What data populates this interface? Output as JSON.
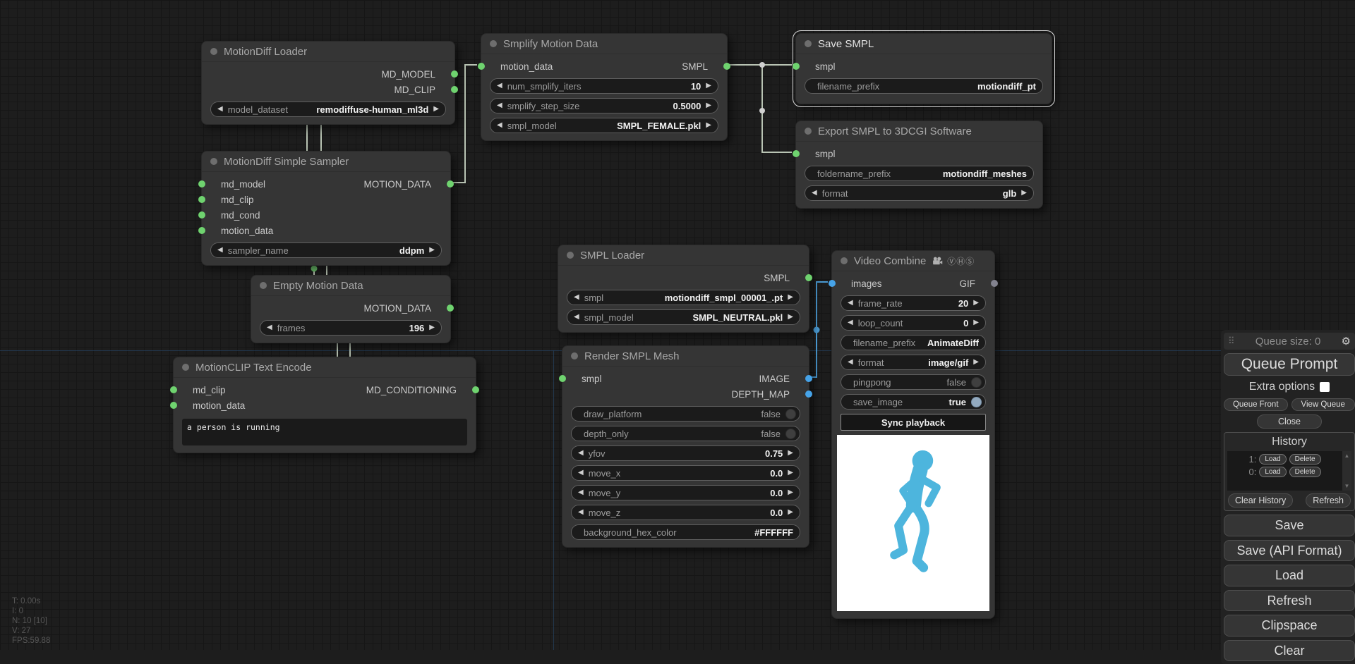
{
  "canvas": {
    "stats": [
      "T: 0.00s",
      "I: 0",
      "N: 10 [10]",
      "V: 27",
      "FPS:59.88"
    ]
  },
  "glyphs": {
    "arrow_left": "◀",
    "arrow_right": "▶",
    "gear": "⚙",
    "drag": "⠿",
    "scroll_up": "▲",
    "scroll_down": "▼",
    "vhs": "ⓋⒽⓈ"
  },
  "colors": {
    "slot_green": "#6fd36f",
    "slot_blue": "#46a3e8",
    "slot_gray": "#82828e",
    "wire_pale": "#b9c4b4",
    "wire_blue": "#4a9ad2",
    "selected_border": "#dcdcdc",
    "toggle_on": "#93aabf",
    "runner_blue": "#4db5dd",
    "preview_bg": "#ffffff"
  },
  "nodes": [
    {
      "id": "motiondiff_loader",
      "title": "MotionDiff Loader",
      "rows": [
        {
          "output": {
            "label": "MD_MODEL",
            "color": "green"
          }
        },
        {
          "output": {
            "label": "MD_CLIP",
            "color": "green"
          }
        }
      ],
      "widgets": [
        {
          "kind": "combo",
          "label": "model_dataset",
          "value": "remodiffuse-human_ml3d"
        }
      ]
    },
    {
      "id": "smplify_motion_data",
      "title": "Smplify Motion Data",
      "rows": [
        {
          "input": {
            "label": "motion_data",
            "color": "green"
          },
          "output": {
            "label": "SMPL",
            "color": "green"
          }
        }
      ],
      "widgets": [
        {
          "kind": "number",
          "label": "num_smplify_iters",
          "value": "10"
        },
        {
          "kind": "number",
          "label": "smplify_step_size",
          "value": "0.5000"
        },
        {
          "kind": "combo",
          "label": "smpl_model",
          "value": "SMPL_FEMALE.pkl"
        }
      ]
    },
    {
      "id": "save_smpl",
      "title": "Save SMPL",
      "selected": true,
      "rows": [
        {
          "input": {
            "label": "smpl",
            "color": "green"
          }
        }
      ],
      "widgets": [
        {
          "kind": "text",
          "label": "filename_prefix",
          "value": "motiondiff_pt"
        }
      ]
    },
    {
      "id": "export_smpl",
      "title": "Export SMPL to 3DCGI Software",
      "rows": [
        {
          "input": {
            "label": "smpl",
            "color": "green"
          }
        }
      ],
      "widgets": [
        {
          "kind": "text",
          "label": "foldername_prefix",
          "value": "motiondiff_meshes"
        },
        {
          "kind": "combo",
          "label": "format",
          "value": "glb"
        }
      ]
    },
    {
      "id": "motiondiff_simple_sampler",
      "title": "MotionDiff Simple Sampler",
      "rows": [
        {
          "input": {
            "label": "md_model",
            "color": "green"
          },
          "output": {
            "label": "MOTION_DATA",
            "color": "green"
          }
        },
        {
          "input": {
            "label": "md_clip",
            "color": "green"
          }
        },
        {
          "input": {
            "label": "md_cond",
            "color": "green"
          }
        },
        {
          "input": {
            "label": "motion_data",
            "color": "green"
          }
        }
      ],
      "widgets": [
        {
          "kind": "combo",
          "label": "sampler_name",
          "value": "ddpm"
        }
      ]
    },
    {
      "id": "empty_motion_data",
      "title": "Empty Motion Data",
      "rows": [
        {
          "output": {
            "label": "MOTION_DATA",
            "color": "green"
          }
        }
      ],
      "widgets": [
        {
          "kind": "number",
          "label": "frames",
          "value": "196"
        }
      ]
    },
    {
      "id": "smpl_loader",
      "title": "SMPL Loader",
      "rows": [
        {
          "output": {
            "label": "SMPL",
            "color": "green"
          }
        }
      ],
      "widgets": [
        {
          "kind": "combo",
          "label": "smpl",
          "value": "motiondiff_smpl_00001_.pt"
        },
        {
          "kind": "combo",
          "label": "smpl_model",
          "value": "SMPL_NEUTRAL.pkl"
        }
      ]
    },
    {
      "id": "motionclip_text_encode",
      "title": "MotionCLIP Text Encode",
      "rows": [
        {
          "input": {
            "label": "md_clip",
            "color": "green"
          },
          "output": {
            "label": "MD_CONDITIONING",
            "color": "green"
          }
        },
        {
          "input": {
            "label": "motion_data",
            "color": "green"
          }
        }
      ],
      "text": "a person is running"
    },
    {
      "id": "render_smpl_mesh",
      "title": "Render SMPL Mesh",
      "rows": [
        {
          "input": {
            "label": "smpl",
            "color": "green"
          },
          "output": {
            "label": "IMAGE",
            "color": "blue"
          }
        },
        {
          "output": {
            "label": "DEPTH_MAP",
            "color": "blue"
          }
        }
      ],
      "widgets": [
        {
          "kind": "toggle",
          "label": "draw_platform",
          "value": "false",
          "on": false
        },
        {
          "kind": "toggle",
          "label": "depth_only",
          "value": "false",
          "on": false
        },
        {
          "kind": "number",
          "label": "yfov",
          "value": "0.75"
        },
        {
          "kind": "number",
          "label": "move_x",
          "value": "0.0"
        },
        {
          "kind": "number",
          "label": "move_y",
          "value": "0.0"
        },
        {
          "kind": "number",
          "label": "move_z",
          "value": "0.0"
        },
        {
          "kind": "text",
          "label": "background_hex_color",
          "value": "#FFFFFF"
        }
      ]
    },
    {
      "id": "video_combine",
      "title": "Video Combine",
      "badge": true,
      "rows": [
        {
          "input": {
            "label": "images",
            "color": "blue"
          },
          "output": {
            "label": "GIF",
            "color": "gray"
          }
        }
      ],
      "widgets": [
        {
          "kind": "number",
          "label": "frame_rate",
          "value": "20"
        },
        {
          "kind": "number",
          "label": "loop_count",
          "value": "0"
        },
        {
          "kind": "text",
          "label": "filename_prefix",
          "value": "AnimateDiff"
        },
        {
          "kind": "combo",
          "label": "format",
          "value": "image/gif"
        },
        {
          "kind": "toggle",
          "label": "pingpong",
          "value": "false",
          "on": false
        },
        {
          "kind": "toggle",
          "label": "save_image",
          "value": "true",
          "on": true
        },
        {
          "kind": "button",
          "label": "Sync playback"
        }
      ],
      "preview": true
    }
  ],
  "menu": {
    "queue_size": "Queue size: 0",
    "queue_prompt": "Queue Prompt",
    "extra_options": "Extra options",
    "queue_front": "Queue Front",
    "view_queue": "View Queue",
    "close": "Close",
    "history": {
      "title": "History",
      "entries": [
        {
          "index": "1:",
          "load": "Load",
          "delete": "Delete"
        },
        {
          "index": "0:",
          "load": "Load",
          "delete": "Delete"
        }
      ],
      "clear_history": "Clear History",
      "refresh": "Refresh"
    },
    "actions": [
      "Save",
      "Save (API Format)",
      "Load",
      "Refresh",
      "Clipspace",
      "Clear"
    ]
  }
}
